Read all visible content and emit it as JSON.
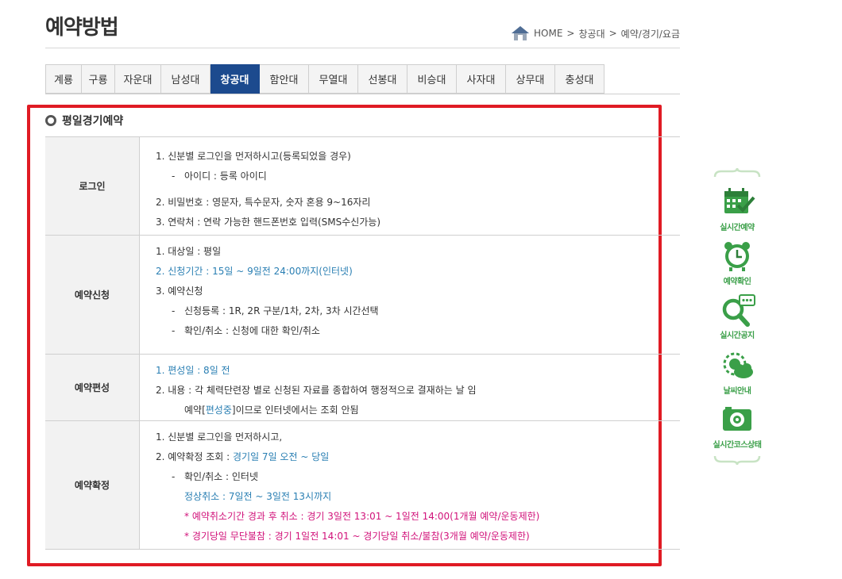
{
  "page": {
    "title": "예약방법",
    "breadcrumb": {
      "home": "HOME",
      "sep": ">",
      "level1": "창공대",
      "level2": "예약/경기/요금"
    }
  },
  "tabs": [
    {
      "label": "계룡",
      "active": false
    },
    {
      "label": "구룡",
      "active": false
    },
    {
      "label": "자운대",
      "active": false
    },
    {
      "label": "남성대",
      "active": false
    },
    {
      "label": "창공대",
      "active": true
    },
    {
      "label": "함안대",
      "active": false
    },
    {
      "label": "무열대",
      "active": false
    },
    {
      "label": "선봉대",
      "active": false
    },
    {
      "label": "비승대",
      "active": false
    },
    {
      "label": "사자대",
      "active": false
    },
    {
      "label": "상무대",
      "active": false
    },
    {
      "label": "충성대",
      "active": false
    }
  ],
  "section": {
    "title": "평일경기예약",
    "rows": [
      {
        "label": "로그인",
        "lines": [
          {
            "text": "1. 신분별 로그인을 먼저하시고(등록되었을 경우)"
          },
          {
            "text": "아이디 : 등록 아이디",
            "dash": true
          },
          {
            "text": "2. 비밀번호 : 영문자, 특수문자, 숫자 혼용 9~16자리"
          },
          {
            "text": "3. 연락처 : 연락 가능한 핸드폰번호 입력(SMS수신가능)"
          }
        ]
      },
      {
        "label": "예약신청",
        "lines": [
          {
            "text": "1. 대상일 : 평일"
          },
          {
            "text": "2. 신청기간 : 15일 ~ 9일전 24:00까지(인터넷)"
          },
          {
            "text": "3. 예약신청"
          },
          {
            "text": "신청등록 : 1R, 2R 구분/1차, 2차, 3차 시간선택",
            "dash": true
          },
          {
            "text": "확인/취소 : 신청에 대한 확인/취소",
            "dash": true
          }
        ]
      },
      {
        "label": "예약편성",
        "lines": [
          {
            "text": "1. 편성일 : 8일 전"
          },
          {
            "text": "2. 내용 : 각 체력단련장 별로 신청된 자료를 종합하여 행정적으로 결재하는 날 임"
          },
          {
            "pre": "예약[",
            "highlight": "편성중",
            "post": "]이므로 인터넷에서는 조회 안됨"
          }
        ]
      },
      {
        "label": "예약확정",
        "lines": [
          {
            "text": "1. 신분별 로그인을 먼저하시고,"
          },
          {
            "pre": "2. 예약확정 조회 : ",
            "highlight": "경기일 7일 오전 ~ 당일"
          },
          {
            "text": "확인/취소 : 인터넷",
            "dash": true
          },
          {
            "text": "정상취소 : 7일전 ~ 3일전 13시까지"
          },
          {
            "text": "* 예약취소기간 경과 후 취소 : 경기 3일전 13:01 ~ 1일전 14:00(1개월 예약/운동제한)"
          },
          {
            "text": "* 경기당일 무단불참 : 경기 1일전 14:01 ~ 경기당일 취소/불참(3개월 예약/운동제한)"
          }
        ]
      }
    ]
  },
  "quickmenu": [
    {
      "label": "실시간예약",
      "icon": "calendar-check-icon"
    },
    {
      "label": "예약확인",
      "icon": "alarm-clock-icon"
    },
    {
      "label": "실시간공지",
      "icon": "search-chat-icon"
    },
    {
      "label": "날씨안내",
      "icon": "weather-cloud-icon"
    },
    {
      "label": "실시간코스상태",
      "icon": "camera-icon"
    }
  ],
  "colors": {
    "active_tab": "#1c4a8e",
    "frame": "#e01b24",
    "blue_text": "#2a7fb3",
    "magenta_text": "#d1127a",
    "quick_green": "#3a9f48"
  }
}
